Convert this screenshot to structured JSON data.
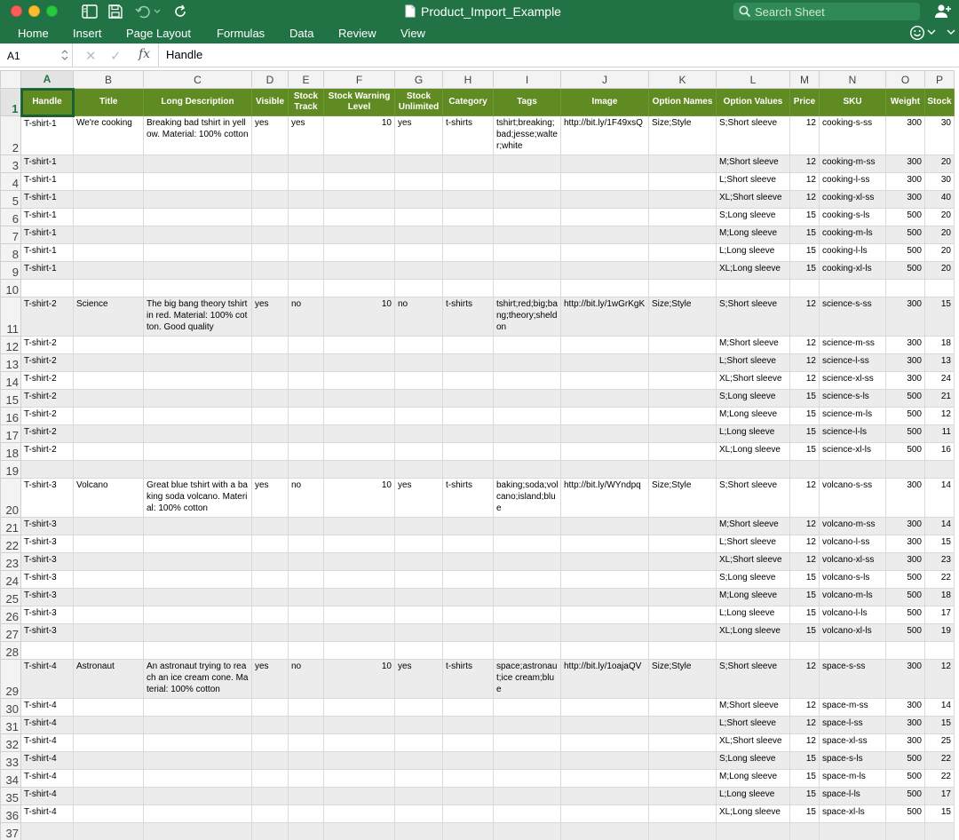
{
  "window": {
    "title": "Product_Import_Example",
    "search_placeholder": "Search Sheet"
  },
  "ribbon": {
    "tabs": [
      "Home",
      "Insert",
      "Page Layout",
      "Formulas",
      "Data",
      "Review",
      "View"
    ]
  },
  "formula_bar": {
    "name_box": "A1",
    "fx": "fx",
    "content": "Handle"
  },
  "columns": [
    "A",
    "B",
    "C",
    "D",
    "E",
    "F",
    "G",
    "H",
    "I",
    "J",
    "K",
    "L",
    "M",
    "N",
    "O",
    "P"
  ],
  "header": [
    "Handle",
    "Title",
    "Long Description",
    "Visible",
    "Stock Track",
    "Stock Warning Level",
    "Stock Unlimited",
    "Category",
    "Tags",
    "Image",
    "Option Names",
    "Option Values",
    "Price",
    "SKU",
    "Weight",
    "Stock"
  ],
  "rows": [
    {
      "n": "1"
    },
    {
      "n": "2",
      "cells": [
        "T-shirt-1",
        "We're cooking",
        "Breaking bad tshirt in yellow. Material: 100% cotton",
        "yes",
        "yes",
        "10",
        "yes",
        "t-shirts",
        "tshirt;breaking;bad;jesse;walter;white",
        "http://bit.ly/1F49xsQ",
        "Size;Style",
        "S;Short sleeve",
        "12",
        "cooking-s-ss",
        "300",
        "30"
      ]
    },
    {
      "n": "3",
      "cells": [
        "T-shirt-1",
        "",
        "",
        "",
        "",
        "",
        "",
        "",
        "",
        "",
        "",
        "M;Short sleeve",
        "12",
        "cooking-m-ss",
        "300",
        "20"
      ]
    },
    {
      "n": "4",
      "cells": [
        "T-shirt-1",
        "",
        "",
        "",
        "",
        "",
        "",
        "",
        "",
        "",
        "",
        "L;Short sleeve",
        "12",
        "cooking-l-ss",
        "300",
        "30"
      ]
    },
    {
      "n": "5",
      "cells": [
        "T-shirt-1",
        "",
        "",
        "",
        "",
        "",
        "",
        "",
        "",
        "",
        "",
        "XL;Short sleeve",
        "12",
        "cooking-xl-ss",
        "300",
        "40"
      ]
    },
    {
      "n": "6",
      "cells": [
        "T-shirt-1",
        "",
        "",
        "",
        "",
        "",
        "",
        "",
        "",
        "",
        "",
        "S;Long sleeve",
        "15",
        "cooking-s-ls",
        "500",
        "20"
      ]
    },
    {
      "n": "7",
      "cells": [
        "T-shirt-1",
        "",
        "",
        "",
        "",
        "",
        "",
        "",
        "",
        "",
        "",
        "M;Long sleeve",
        "15",
        "cooking-m-ls",
        "500",
        "20"
      ]
    },
    {
      "n": "8",
      "cells": [
        "T-shirt-1",
        "",
        "",
        "",
        "",
        "",
        "",
        "",
        "",
        "",
        "",
        "L;Long sleeve",
        "15",
        "cooking-l-ls",
        "500",
        "20"
      ]
    },
    {
      "n": "9",
      "cells": [
        "T-shirt-1",
        "",
        "",
        "",
        "",
        "",
        "",
        "",
        "",
        "",
        "",
        "XL;Long sleeve",
        "15",
        "cooking-xl-ls",
        "500",
        "20"
      ]
    },
    {
      "n": "10",
      "cells": [
        "",
        "",
        "",
        "",
        "",
        "",
        "",
        "",
        "",
        "",
        "",
        "",
        "",
        "",
        "",
        ""
      ]
    },
    {
      "n": "11",
      "cells": [
        "T-shirt-2",
        "Science",
        "The big bang theory tshirt in red. Material: 100% cotton. Good quality",
        "yes",
        "no",
        "10",
        "no",
        "t-shirts",
        "tshirt;red;big;bang;theory;sheldon",
        "http://bit.ly/1wGrKgK",
        "Size;Style",
        "S;Short sleeve",
        "12",
        "science-s-ss",
        "300",
        "15"
      ]
    },
    {
      "n": "12",
      "cells": [
        "T-shirt-2",
        "",
        "",
        "",
        "",
        "",
        "",
        "",
        "",
        "",
        "",
        "M;Short sleeve",
        "12",
        "science-m-ss",
        "300",
        "18"
      ]
    },
    {
      "n": "13",
      "cells": [
        "T-shirt-2",
        "",
        "",
        "",
        "",
        "",
        "",
        "",
        "",
        "",
        "",
        "L;Short sleeve",
        "12",
        "science-l-ss",
        "300",
        "13"
      ]
    },
    {
      "n": "14",
      "cells": [
        "T-shirt-2",
        "",
        "",
        "",
        "",
        "",
        "",
        "",
        "",
        "",
        "",
        "XL;Short sleeve",
        "12",
        "science-xl-ss",
        "300",
        "24"
      ]
    },
    {
      "n": "15",
      "cells": [
        "T-shirt-2",
        "",
        "",
        "",
        "",
        "",
        "",
        "",
        "",
        "",
        "",
        "S;Long sleeve",
        "15",
        "science-s-ls",
        "500",
        "21"
      ]
    },
    {
      "n": "16",
      "cells": [
        "T-shirt-2",
        "",
        "",
        "",
        "",
        "",
        "",
        "",
        "",
        "",
        "",
        "M;Long sleeve",
        "15",
        "science-m-ls",
        "500",
        "12"
      ]
    },
    {
      "n": "17",
      "cells": [
        "T-shirt-2",
        "",
        "",
        "",
        "",
        "",
        "",
        "",
        "",
        "",
        "",
        "L;Long sleeve",
        "15",
        "science-l-ls",
        "500",
        "11"
      ]
    },
    {
      "n": "18",
      "cells": [
        "T-shirt-2",
        "",
        "",
        "",
        "",
        "",
        "",
        "",
        "",
        "",
        "",
        "XL;Long sleeve",
        "15",
        "science-xl-ls",
        "500",
        "16"
      ]
    },
    {
      "n": "19",
      "cells": [
        "",
        "",
        "",
        "",
        "",
        "",
        "",
        "",
        "",
        "",
        "",
        "",
        "",
        "",
        "",
        ""
      ]
    },
    {
      "n": "20",
      "cells": [
        "T-shirt-3",
        "Volcano",
        "Great blue tshirt with a baking soda volcano. Material: 100% cotton",
        "yes",
        "no",
        "10",
        "yes",
        "t-shirts",
        "baking;soda;volcano;island;blue",
        "http://bit.ly/WYndpq",
        "Size;Style",
        "S;Short sleeve",
        "12",
        "volcano-s-ss",
        "300",
        "14"
      ]
    },
    {
      "n": "21",
      "cells": [
        "T-shirt-3",
        "",
        "",
        "",
        "",
        "",
        "",
        "",
        "",
        "",
        "",
        "M;Short sleeve",
        "12",
        "volcano-m-ss",
        "300",
        "14"
      ]
    },
    {
      "n": "22",
      "cells": [
        "T-shirt-3",
        "",
        "",
        "",
        "",
        "",
        "",
        "",
        "",
        "",
        "",
        "L;Short sleeve",
        "12",
        "volcano-l-ss",
        "300",
        "15"
      ]
    },
    {
      "n": "23",
      "cells": [
        "T-shirt-3",
        "",
        "",
        "",
        "",
        "",
        "",
        "",
        "",
        "",
        "",
        "XL;Short sleeve",
        "12",
        "volcano-xl-ss",
        "300",
        "23"
      ]
    },
    {
      "n": "24",
      "cells": [
        "T-shirt-3",
        "",
        "",
        "",
        "",
        "",
        "",
        "",
        "",
        "",
        "",
        "S;Long sleeve",
        "15",
        "volcano-s-ls",
        "500",
        "22"
      ]
    },
    {
      "n": "25",
      "cells": [
        "T-shirt-3",
        "",
        "",
        "",
        "",
        "",
        "",
        "",
        "",
        "",
        "",
        "M;Long sleeve",
        "15",
        "volcano-m-ls",
        "500",
        "18"
      ]
    },
    {
      "n": "26",
      "cells": [
        "T-shirt-3",
        "",
        "",
        "",
        "",
        "",
        "",
        "",
        "",
        "",
        "",
        "L;Long sleeve",
        "15",
        "volcano-l-ls",
        "500",
        "17"
      ]
    },
    {
      "n": "27",
      "cells": [
        "T-shirt-3",
        "",
        "",
        "",
        "",
        "",
        "",
        "",
        "",
        "",
        "",
        "XL;Long sleeve",
        "15",
        "volcano-xl-ls",
        "500",
        "19"
      ]
    },
    {
      "n": "28",
      "cells": [
        "",
        "",
        "",
        "",
        "",
        "",
        "",
        "",
        "",
        "",
        "",
        "",
        "",
        "",
        "",
        ""
      ]
    },
    {
      "n": "29",
      "cells": [
        "T-shirt-4",
        "Astronaut",
        "An astronaut trying to reach an ice cream cone. Material: 100% cotton",
        "yes",
        "no",
        "10",
        "yes",
        "t-shirts",
        "space;astronaut;ice cream;blue",
        "http://bit.ly/1oajaQV",
        "Size;Style",
        "S;Short sleeve",
        "12",
        "space-s-ss",
        "300",
        "12"
      ]
    },
    {
      "n": "30",
      "cells": [
        "T-shirt-4",
        "",
        "",
        "",
        "",
        "",
        "",
        "",
        "",
        "",
        "",
        "M;Short sleeve",
        "12",
        "space-m-ss",
        "300",
        "14"
      ]
    },
    {
      "n": "31",
      "cells": [
        "T-shirt-4",
        "",
        "",
        "",
        "",
        "",
        "",
        "",
        "",
        "",
        "",
        "L;Short sleeve",
        "12",
        "space-l-ss",
        "300",
        "15"
      ]
    },
    {
      "n": "32",
      "cells": [
        "T-shirt-4",
        "",
        "",
        "",
        "",
        "",
        "",
        "",
        "",
        "",
        "",
        "XL;Short sleeve",
        "12",
        "space-xl-ss",
        "300",
        "25"
      ]
    },
    {
      "n": "33",
      "cells": [
        "T-shirt-4",
        "",
        "",
        "",
        "",
        "",
        "",
        "",
        "",
        "",
        "",
        "S;Long sleeve",
        "15",
        "space-s-ls",
        "500",
        "22"
      ]
    },
    {
      "n": "34",
      "cells": [
        "T-shirt-4",
        "",
        "",
        "",
        "",
        "",
        "",
        "",
        "",
        "",
        "",
        "M;Long sleeve",
        "15",
        "space-m-ls",
        "500",
        "22"
      ]
    },
    {
      "n": "35",
      "cells": [
        "T-shirt-4",
        "",
        "",
        "",
        "",
        "",
        "",
        "",
        "",
        "",
        "",
        "L;Long sleeve",
        "15",
        "space-l-ls",
        "500",
        "17"
      ]
    },
    {
      "n": "36",
      "cells": [
        "T-shirt-4",
        "",
        "",
        "",
        "",
        "",
        "",
        "",
        "",
        "",
        "",
        "XL;Long sleeve",
        "15",
        "space-xl-ls",
        "500",
        "15"
      ]
    },
    {
      "n": "37",
      "cells": [
        "",
        "",
        "",
        "",
        "",
        "",
        "",
        "",
        "",
        "",
        "",
        "",
        "",
        "",
        "",
        ""
      ]
    }
  ],
  "colors": {
    "title_bar": "#217346",
    "header_fill": "#5f8b22",
    "band_fill": "#ececec",
    "selection": "#217346"
  },
  "active_cell": "A1"
}
